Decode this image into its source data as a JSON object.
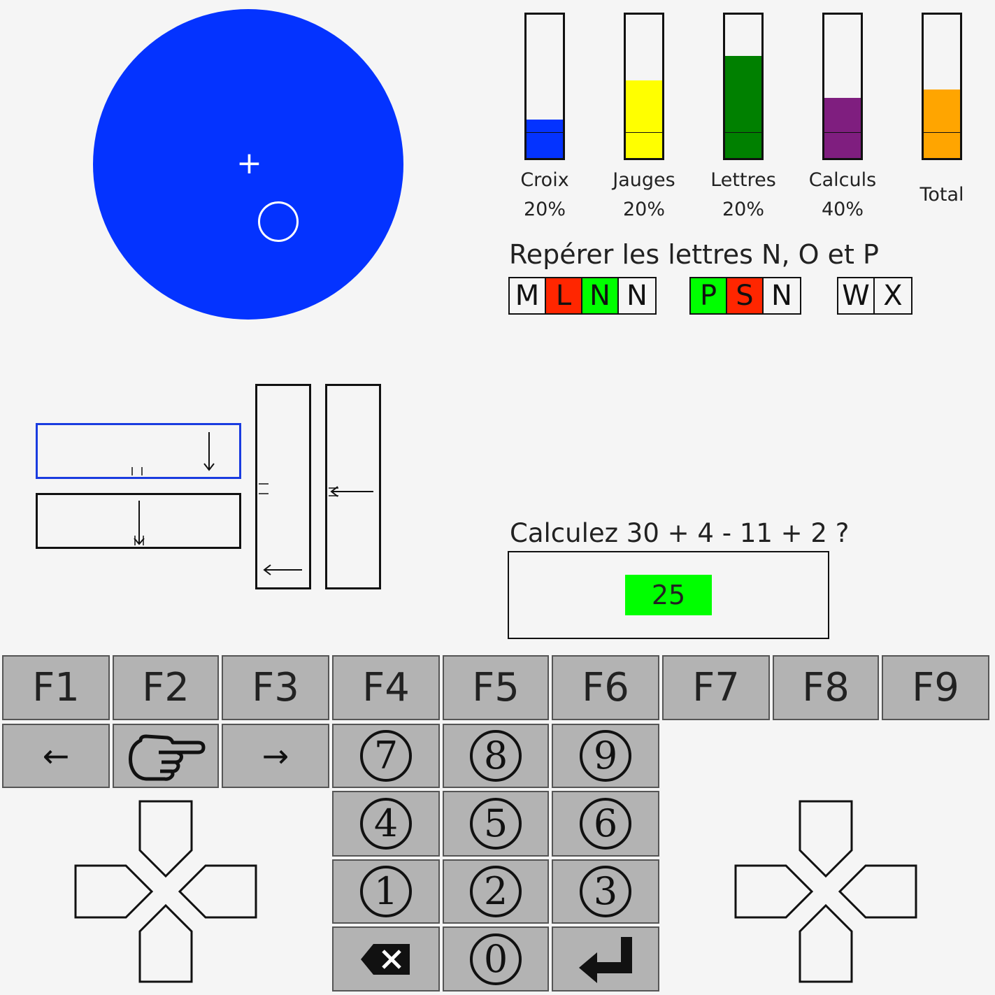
{
  "tracking": {
    "crosshair": "+"
  },
  "gauges": [
    {
      "name": "Croix",
      "percent": "20%",
      "fill_level": 0.27,
      "color": "#0433ff"
    },
    {
      "name": "Jauges",
      "percent": "20%",
      "fill_level": 0.54,
      "color": "#ffff00"
    },
    {
      "name": "Lettres",
      "percent": "20%",
      "fill_level": 0.71,
      "color": "#008000"
    },
    {
      "name": "Calculs",
      "percent": "40%",
      "fill_level": 0.42,
      "color": "#7f1e7f"
    },
    {
      "name": "Total",
      "percent": "",
      "fill_level": 0.48,
      "color": "#ffa500"
    }
  ],
  "letters": {
    "title": "Repérer les lettres N, O et P",
    "groups": [
      [
        {
          "char": "M",
          "state": "none"
        },
        {
          "char": "L",
          "state": "wrong"
        },
        {
          "char": "N",
          "state": "correct"
        },
        {
          "char": "N",
          "state": "none"
        }
      ],
      [
        {
          "char": "P",
          "state": "correct"
        },
        {
          "char": "S",
          "state": "wrong"
        },
        {
          "char": "N",
          "state": "none"
        }
      ],
      [
        {
          "char": "W",
          "state": "none"
        },
        {
          "char": "X",
          "state": "none"
        }
      ]
    ],
    "state_colors": {
      "none": "#f5f5f5",
      "wrong": "#ff2600",
      "correct": "#00ff00"
    }
  },
  "calc": {
    "question": "Calculez 30 + 4 - 11 + 2 ?",
    "answer": "25"
  },
  "function_keys": [
    "F1",
    "F2",
    "F3",
    "F4",
    "F5",
    "F6",
    "F7",
    "F8",
    "F9"
  ],
  "nav_keys": {
    "left": "←",
    "point": "pointing-hand-icon",
    "right": "→"
  },
  "numpad": {
    "row1": [
      "7",
      "8",
      "9"
    ],
    "row2": [
      "4",
      "5",
      "6"
    ],
    "row3": [
      "1",
      "2",
      "3"
    ],
    "zero": "0",
    "backspace": "backspace-icon",
    "enter": "enter-icon"
  },
  "colors": {
    "accent": "#0433ff",
    "key_bg": "#b3b3b3",
    "background": "#f5f5f5"
  }
}
